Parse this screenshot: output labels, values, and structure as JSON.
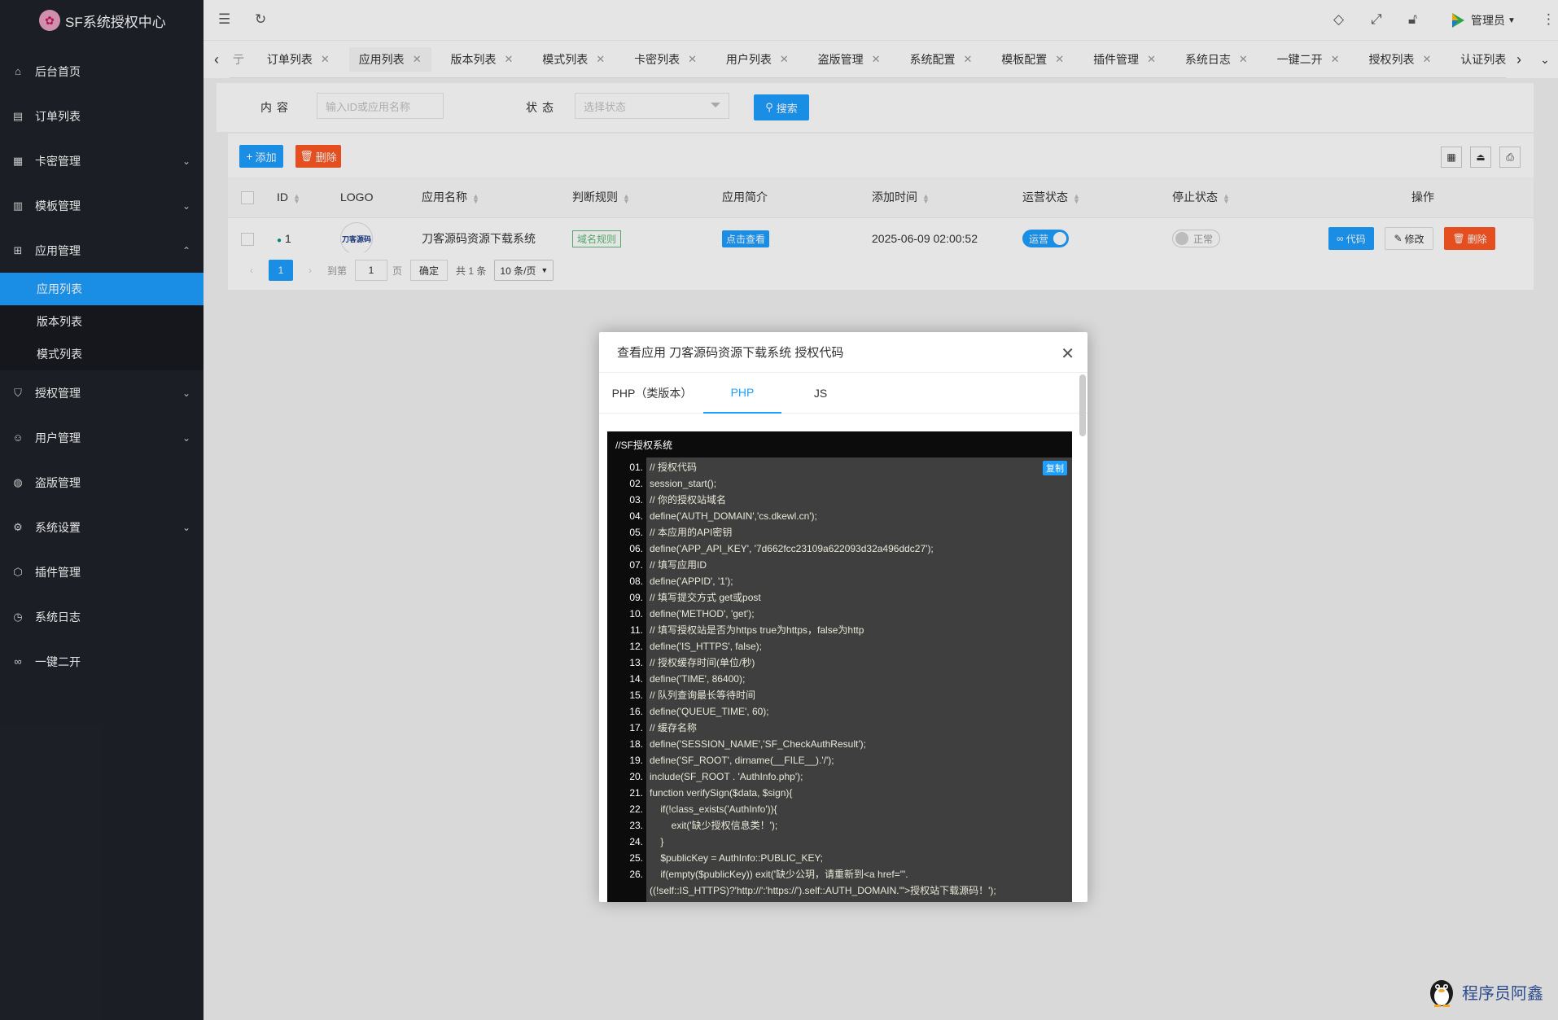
{
  "sidebar": {
    "logo_text": "SF系统授权中心",
    "items": [
      {
        "label": "后台首页",
        "icon": "home-icon"
      },
      {
        "label": "订单列表",
        "icon": "list-icon"
      },
      {
        "label": "卡密管理",
        "icon": "grid-icon"
      },
      {
        "label": "模板管理",
        "icon": "template-icon"
      },
      {
        "label": "应用管理",
        "icon": "apps-icon"
      }
    ],
    "submenu": [
      "应用列表",
      "版本列表",
      "模式列表"
    ],
    "items_after": [
      {
        "label": "授权管理",
        "icon": "shield-icon"
      },
      {
        "label": "用户管理",
        "icon": "user-icon"
      },
      {
        "label": "盗版管理",
        "icon": "globe-icon"
      },
      {
        "label": "系统设置",
        "icon": "gear-icon"
      },
      {
        "label": "插件管理",
        "icon": "cube-icon"
      },
      {
        "label": "系统日志",
        "icon": "clock-icon"
      },
      {
        "label": "一键二开",
        "icon": "infinity-icon"
      }
    ]
  },
  "header": {
    "user_label": "管理员"
  },
  "tabs": [
    "订单列表",
    "应用列表",
    "版本列表",
    "模式列表",
    "卡密列表",
    "用户列表",
    "盗版管理",
    "系统配置",
    "模板配置",
    "插件管理",
    "系统日志",
    "一键二开",
    "授权列表",
    "认证列表"
  ],
  "search": {
    "content_label": "内容",
    "content_placeholder": "输入ID或应用名称",
    "status_label": "状态",
    "status_placeholder": "选择状态",
    "search_button": "搜索"
  },
  "toolbar": {
    "add_label": "添加",
    "delete_label": "删除"
  },
  "table": {
    "headers": [
      "ID",
      "LOGO",
      "应用名称",
      "判断规则",
      "应用简介",
      "添加时间",
      "运营状态",
      "停止状态",
      "操作"
    ],
    "rows": [
      {
        "id": "1",
        "logo_text": "刀客源码",
        "name": "刀客源码资源下载系统",
        "rule": "域名规则",
        "intro": "点击查看",
        "added": "2025-06-09 02:00:52",
        "run_status": "运营",
        "stop_status": "正常",
        "btn_code": "代码",
        "btn_edit": "修改",
        "btn_delete": "删除"
      }
    ]
  },
  "pager": {
    "current": "1",
    "goto_label": "到第",
    "page_input": "1",
    "page_suffix": "页",
    "confirm": "确定",
    "total": "共 1 条",
    "limit": "10 条/页"
  },
  "modal": {
    "title": "查看应用 刀客源码资源下载系统 授权代码",
    "tabs": [
      "PHP（类版本）",
      "PHP",
      "JS"
    ],
    "active_tab": "PHP",
    "code_header": "//SF授权系统",
    "copy_label": "复制",
    "lines": [
      {
        "n": "01.",
        "code": "// 授权代码"
      },
      {
        "n": "02.",
        "code": "session_start();"
      },
      {
        "n": "03.",
        "code": "// 你的授权站域名"
      },
      {
        "n": "04.",
        "code": "define('AUTH_DOMAIN','cs.dkewl.cn');"
      },
      {
        "n": "05.",
        "code": "// 本应用的API密钥"
      },
      {
        "n": "06.",
        "code": "define('APP_API_KEY', '7d662fcc23109a622093d32a496ddc27');"
      },
      {
        "n": "07.",
        "code": "// 填写应用ID"
      },
      {
        "n": "08.",
        "code": "define('APPID', '1');"
      },
      {
        "n": "09.",
        "code": "// 填写提交方式 get或post"
      },
      {
        "n": "10.",
        "code": "define('METHOD', 'get');"
      },
      {
        "n": "11.",
        "code": "// 填写授权站是否为https true为https，false为http"
      },
      {
        "n": "12.",
        "code": "define('IS_HTTPS', false);"
      },
      {
        "n": "13.",
        "code": "// 授权缓存时间(单位/秒)"
      },
      {
        "n": "14.",
        "code": "define('TIME', 86400);"
      },
      {
        "n": "15.",
        "code": "// 队列查询最长等待时间"
      },
      {
        "n": "16.",
        "code": "define('QUEUE_TIME', 60);"
      },
      {
        "n": "17.",
        "code": "// 缓存名称"
      },
      {
        "n": "18.",
        "code": "define('SESSION_NAME','SF_CheckAuthResult');"
      },
      {
        "n": "19.",
        "code": "define('SF_ROOT', dirname(__FILE__).'/');"
      },
      {
        "n": "20.",
        "code": "include(SF_ROOT . 'AuthInfo.php');"
      },
      {
        "n": "21.",
        "code": "function verifySign($data, $sign){"
      },
      {
        "n": "22.",
        "code": "    if(!class_exists('AuthInfo')){"
      },
      {
        "n": "23.",
        "code": "        exit('缺少授权信息类！');"
      },
      {
        "n": "24.",
        "code": "    }"
      },
      {
        "n": "25.",
        "code": "    $publicKey = AuthInfo::PUBLIC_KEY;"
      },
      {
        "n": "26.",
        "code": "    if(empty($publicKey)) exit('缺少公玥，请重新到<a href=\"'."
      },
      {
        "n": "",
        "code": "((!self::IS_HTTPS)?'http://':'https://').self::AUTH_DOMAIN.'\">授权站下载源码！');"
      }
    ]
  },
  "watermark": "程序员阿鑫"
}
